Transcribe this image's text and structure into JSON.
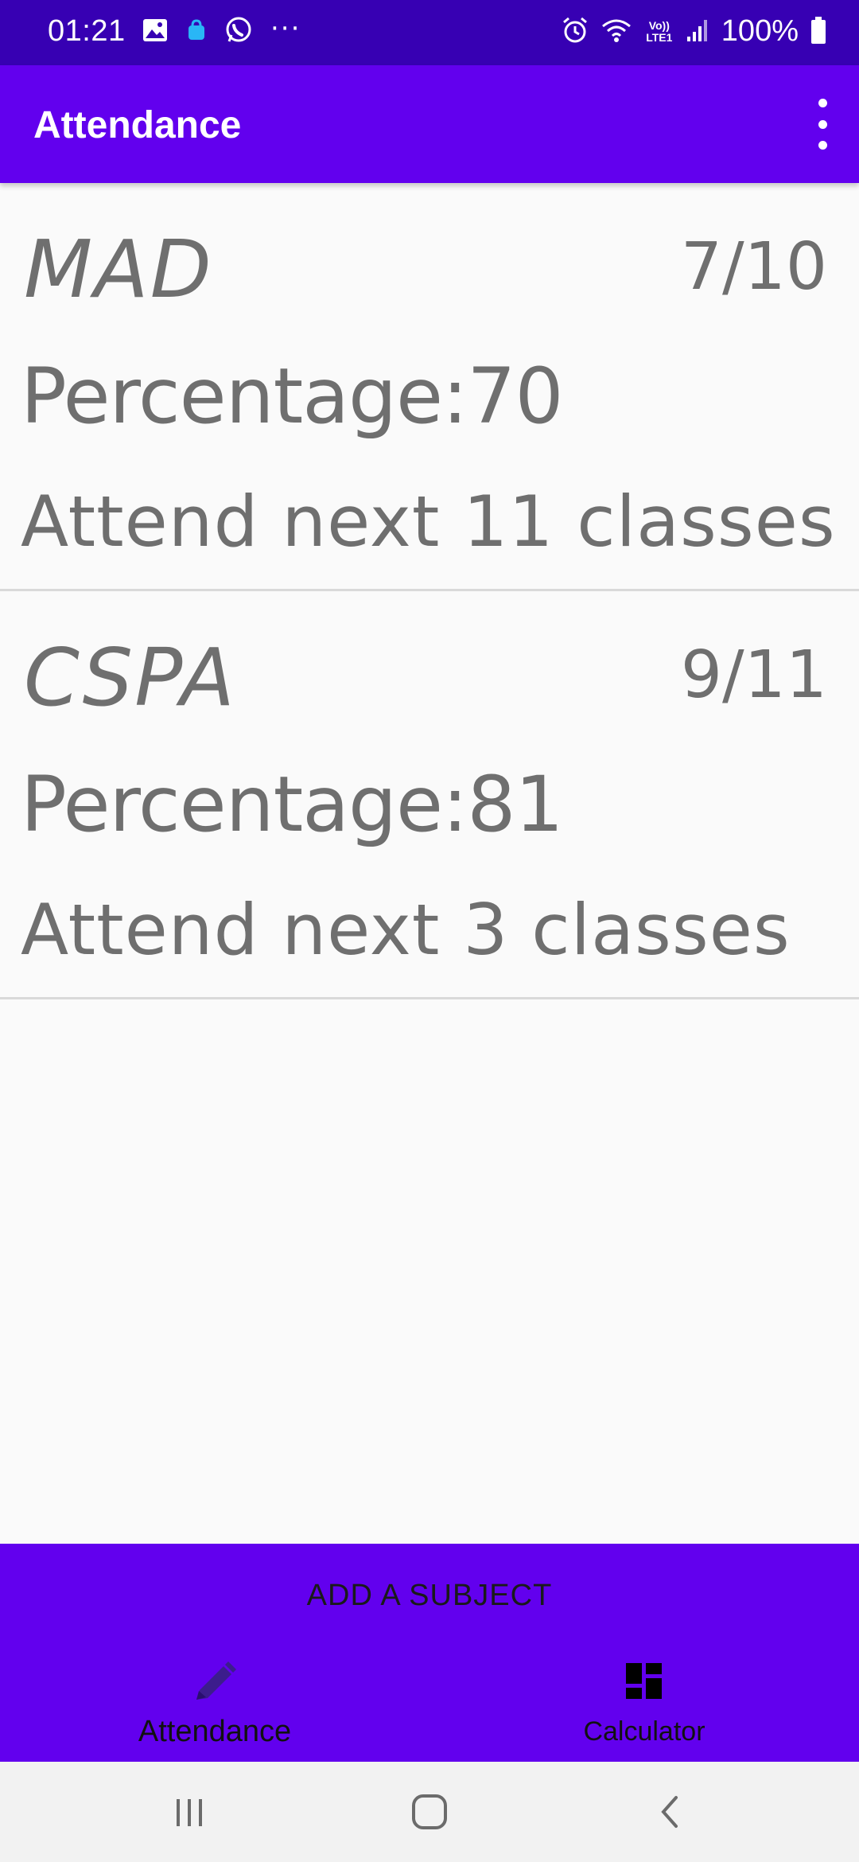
{
  "status_bar": {
    "time": "01:21",
    "battery": "100%",
    "icons_left": [
      "gallery-icon",
      "shopping-bag-icon",
      "whatsapp-icon",
      "more-notifications-icon"
    ],
    "icons_right": [
      "alarm-icon",
      "wifi-icon",
      "volte-icon",
      "signal-icon",
      "battery-icon"
    ],
    "more_dots": "···",
    "volte_text": "Vo)) LTE1"
  },
  "app_bar": {
    "title": "Attendance"
  },
  "subjects": [
    {
      "name": "MAD",
      "ratio": "7/10",
      "percentage": "Percentage:70",
      "advice": "Attend next 11 classes"
    },
    {
      "name": "CSPA",
      "ratio": "9/11",
      "percentage": "Percentage:81",
      "advice": "Attend next 3 classes"
    }
  ],
  "add_subject_label": "ADD A SUBJECT",
  "bottom_nav": {
    "items": [
      {
        "label": "Attendance",
        "icon": "pencil-icon",
        "active": true
      },
      {
        "label": "Calculator",
        "icon": "dashboard-icon",
        "active": false
      }
    ]
  },
  "colors": {
    "status_bar": "#3700b3",
    "primary": "#6200ee",
    "card_text": "#6f6f6f",
    "background": "#fafafa"
  }
}
